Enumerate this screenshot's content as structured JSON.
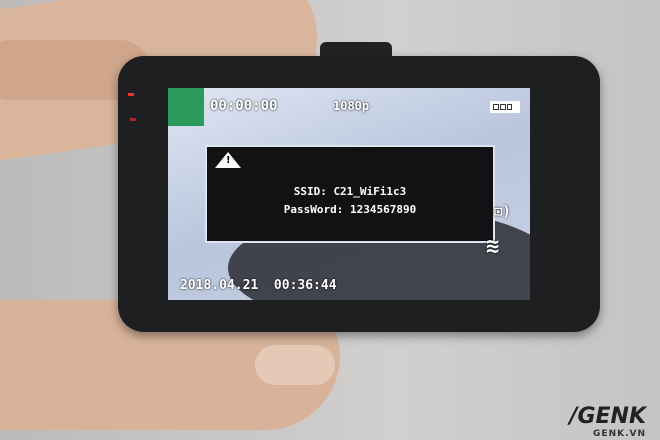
{
  "screen": {
    "rec_timer": "00:00:00",
    "resolution": "1080p",
    "battery_level": 0.75,
    "dialog": {
      "icon": "warning-icon",
      "ssid_line": "SSID: C21_WiFi1c3",
      "password_line": "PassWord: 1234567890"
    },
    "status_icons": [
      "wifi-client-icon",
      "wifi-signal-icon"
    ],
    "datetime": "2018.04.21  00:36:44"
  },
  "watermark": {
    "brand": "/GENK",
    "url": "GENK.VN"
  }
}
